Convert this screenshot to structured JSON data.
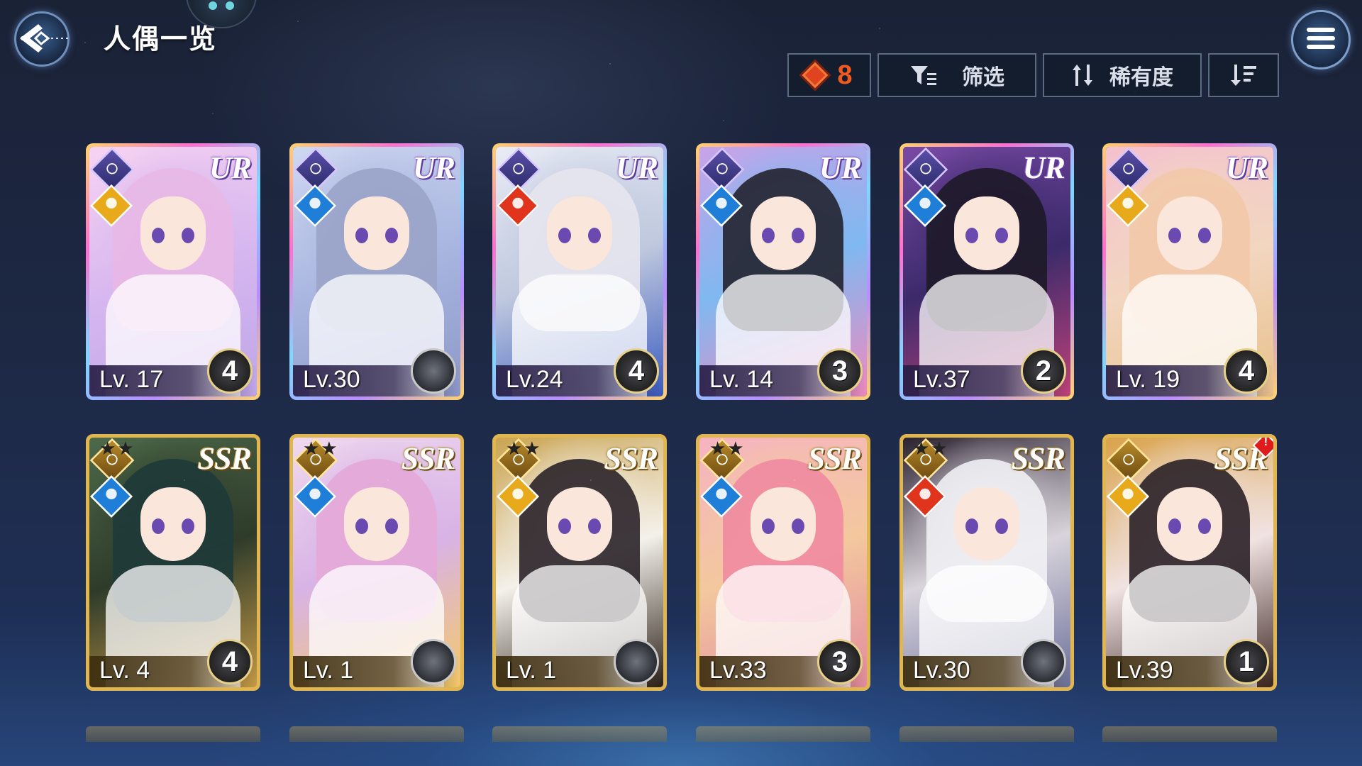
{
  "header": {
    "title": "人偶一览"
  },
  "toolbar": {
    "count": "8",
    "filter_label": "筛选",
    "sort_label": "稀有度",
    "colors": {
      "count": "#f05a1e",
      "border": "#5d6b82"
    }
  },
  "cards": [
    {
      "rarity": "UR",
      "level": "Lv. 17",
      "tier": "4",
      "element": "light-icon"
    },
    {
      "rarity": "UR",
      "level": "Lv.30",
      "tier": "",
      "element": "water-icon"
    },
    {
      "rarity": "UR",
      "level": "Lv.24",
      "tier": "4",
      "element": "fire-icon"
    },
    {
      "rarity": "UR",
      "level": "Lv. 14",
      "tier": "3",
      "element": "water-icon"
    },
    {
      "rarity": "UR",
      "level": "Lv.37",
      "tier": "2",
      "element": "water-icon"
    },
    {
      "rarity": "UR",
      "level": "Lv. 19",
      "tier": "4",
      "element": "light-icon"
    },
    {
      "rarity": "SSR",
      "level": "Lv. 4",
      "tier": "4",
      "element": "water-icon"
    },
    {
      "rarity": "SSR",
      "level": "Lv. 1",
      "tier": "",
      "element": "water-icon"
    },
    {
      "rarity": "SSR",
      "level": "Lv. 1",
      "tier": "",
      "element": "light-icon"
    },
    {
      "rarity": "SSR",
      "level": "Lv.33",
      "tier": "3",
      "element": "water-icon"
    },
    {
      "rarity": "SSR",
      "level": "Lv.30",
      "tier": "",
      "element": "fire-icon"
    },
    {
      "rarity": "SSR",
      "level": "Lv.39",
      "tier": "1",
      "element": "light-icon"
    }
  ]
}
